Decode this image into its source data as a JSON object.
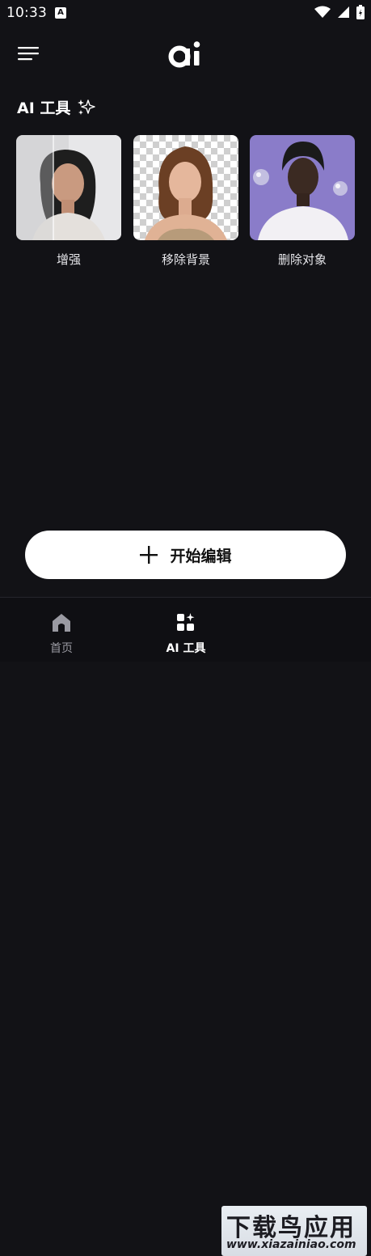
{
  "status_bar": {
    "time": "10:33",
    "notification_letter": "A"
  },
  "header": {
    "logo_text": "ai"
  },
  "section": {
    "title": "AI 工具"
  },
  "tools": [
    {
      "label": "增强"
    },
    {
      "label": "移除背景"
    },
    {
      "label": "删除对象"
    }
  ],
  "cta": {
    "label": "开始编辑"
  },
  "tabs": [
    {
      "label": "首页",
      "active": false
    },
    {
      "label": "AI 工具",
      "active": true
    }
  ],
  "watermark": {
    "title": "下载鸟应用",
    "url": "www.xiazainiao.com"
  },
  "colors": {
    "background": "#121216",
    "button_bg": "#ffffff",
    "tab_inactive": "#9a9aa2",
    "tool_purple": "#8a7cc9"
  }
}
